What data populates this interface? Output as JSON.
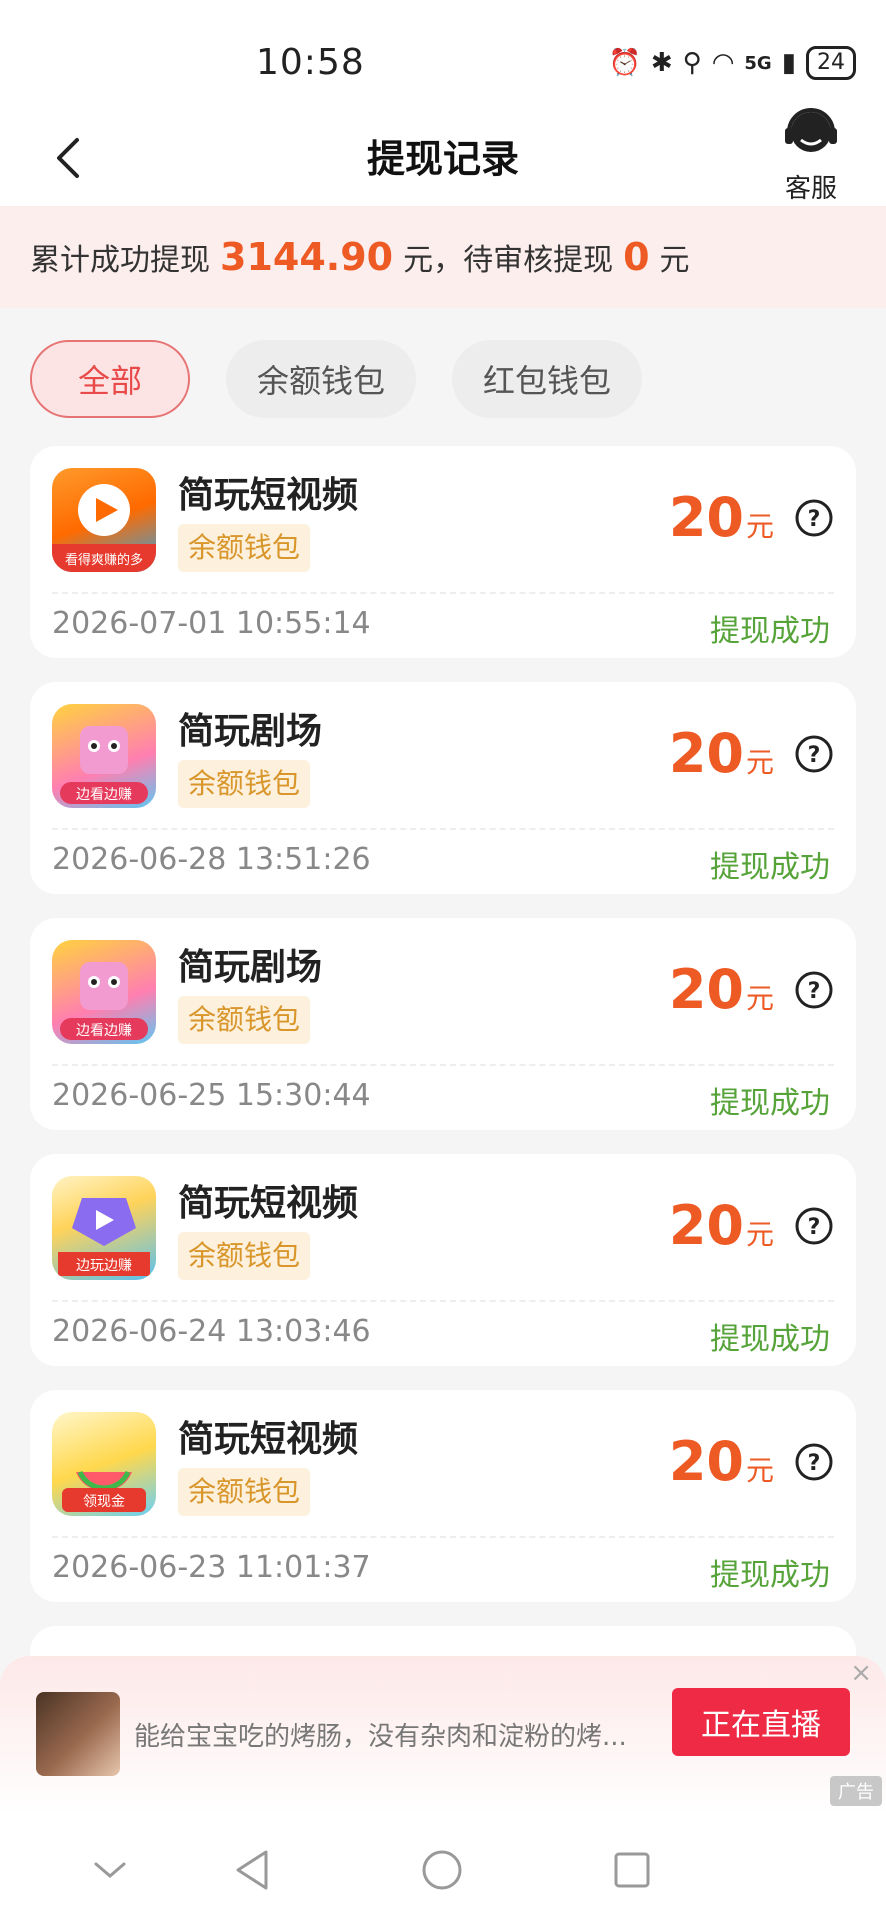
{
  "status_bar": {
    "time": "10:58",
    "network": "5G",
    "battery": "24"
  },
  "header": {
    "title": "提现记录",
    "service_label": "客服"
  },
  "summary": {
    "prefix": "累计成功提现",
    "total": "3144.90",
    "mid": "元，待审核提现",
    "pending": "0",
    "suffix": "元"
  },
  "tabs": [
    {
      "label": "全部",
      "active": true
    },
    {
      "label": "余额钱包",
      "active": false
    },
    {
      "label": "红包钱包",
      "active": false
    }
  ],
  "records": [
    {
      "app": "简玩短视频",
      "wallet": "余额钱包",
      "amount": "20",
      "unit": "元",
      "time": "2026-07-01 10:55:14",
      "status": "提现成功",
      "icon_text": "看得爽赚的多"
    },
    {
      "app": "简玩剧场",
      "wallet": "余额钱包",
      "amount": "20",
      "unit": "元",
      "time": "2026-06-28 13:51:26",
      "status": "提现成功",
      "icon_text": "边看边赚"
    },
    {
      "app": "简玩剧场",
      "wallet": "余额钱包",
      "amount": "20",
      "unit": "元",
      "time": "2026-06-25 15:30:44",
      "status": "提现成功",
      "icon_text": "边看边赚"
    },
    {
      "app": "简玩短视频",
      "wallet": "余额钱包",
      "amount": "20",
      "unit": "元",
      "time": "2026-06-24 13:03:46",
      "status": "提现成功",
      "icon_text": "边玩边赚"
    },
    {
      "app": "简玩短视频",
      "wallet": "余额钱包",
      "amount": "20",
      "unit": "元",
      "time": "2026-06-23 11:01:37",
      "status": "提现成功",
      "icon_text": "领现金"
    }
  ],
  "ad": {
    "text": "能给宝宝吃的烤肠，没有杂肉和淀粉的烤...",
    "button": "正在直播",
    "tag": "广告",
    "close": "×"
  },
  "icons": {
    "back": "chevron-left-icon",
    "service": "headset-icon",
    "help": "question-circle-icon"
  },
  "colors": {
    "accent": "#ee5a24",
    "success": "#56a339",
    "tag_bg": "#fdf0dc",
    "live": "#ef2a45"
  }
}
